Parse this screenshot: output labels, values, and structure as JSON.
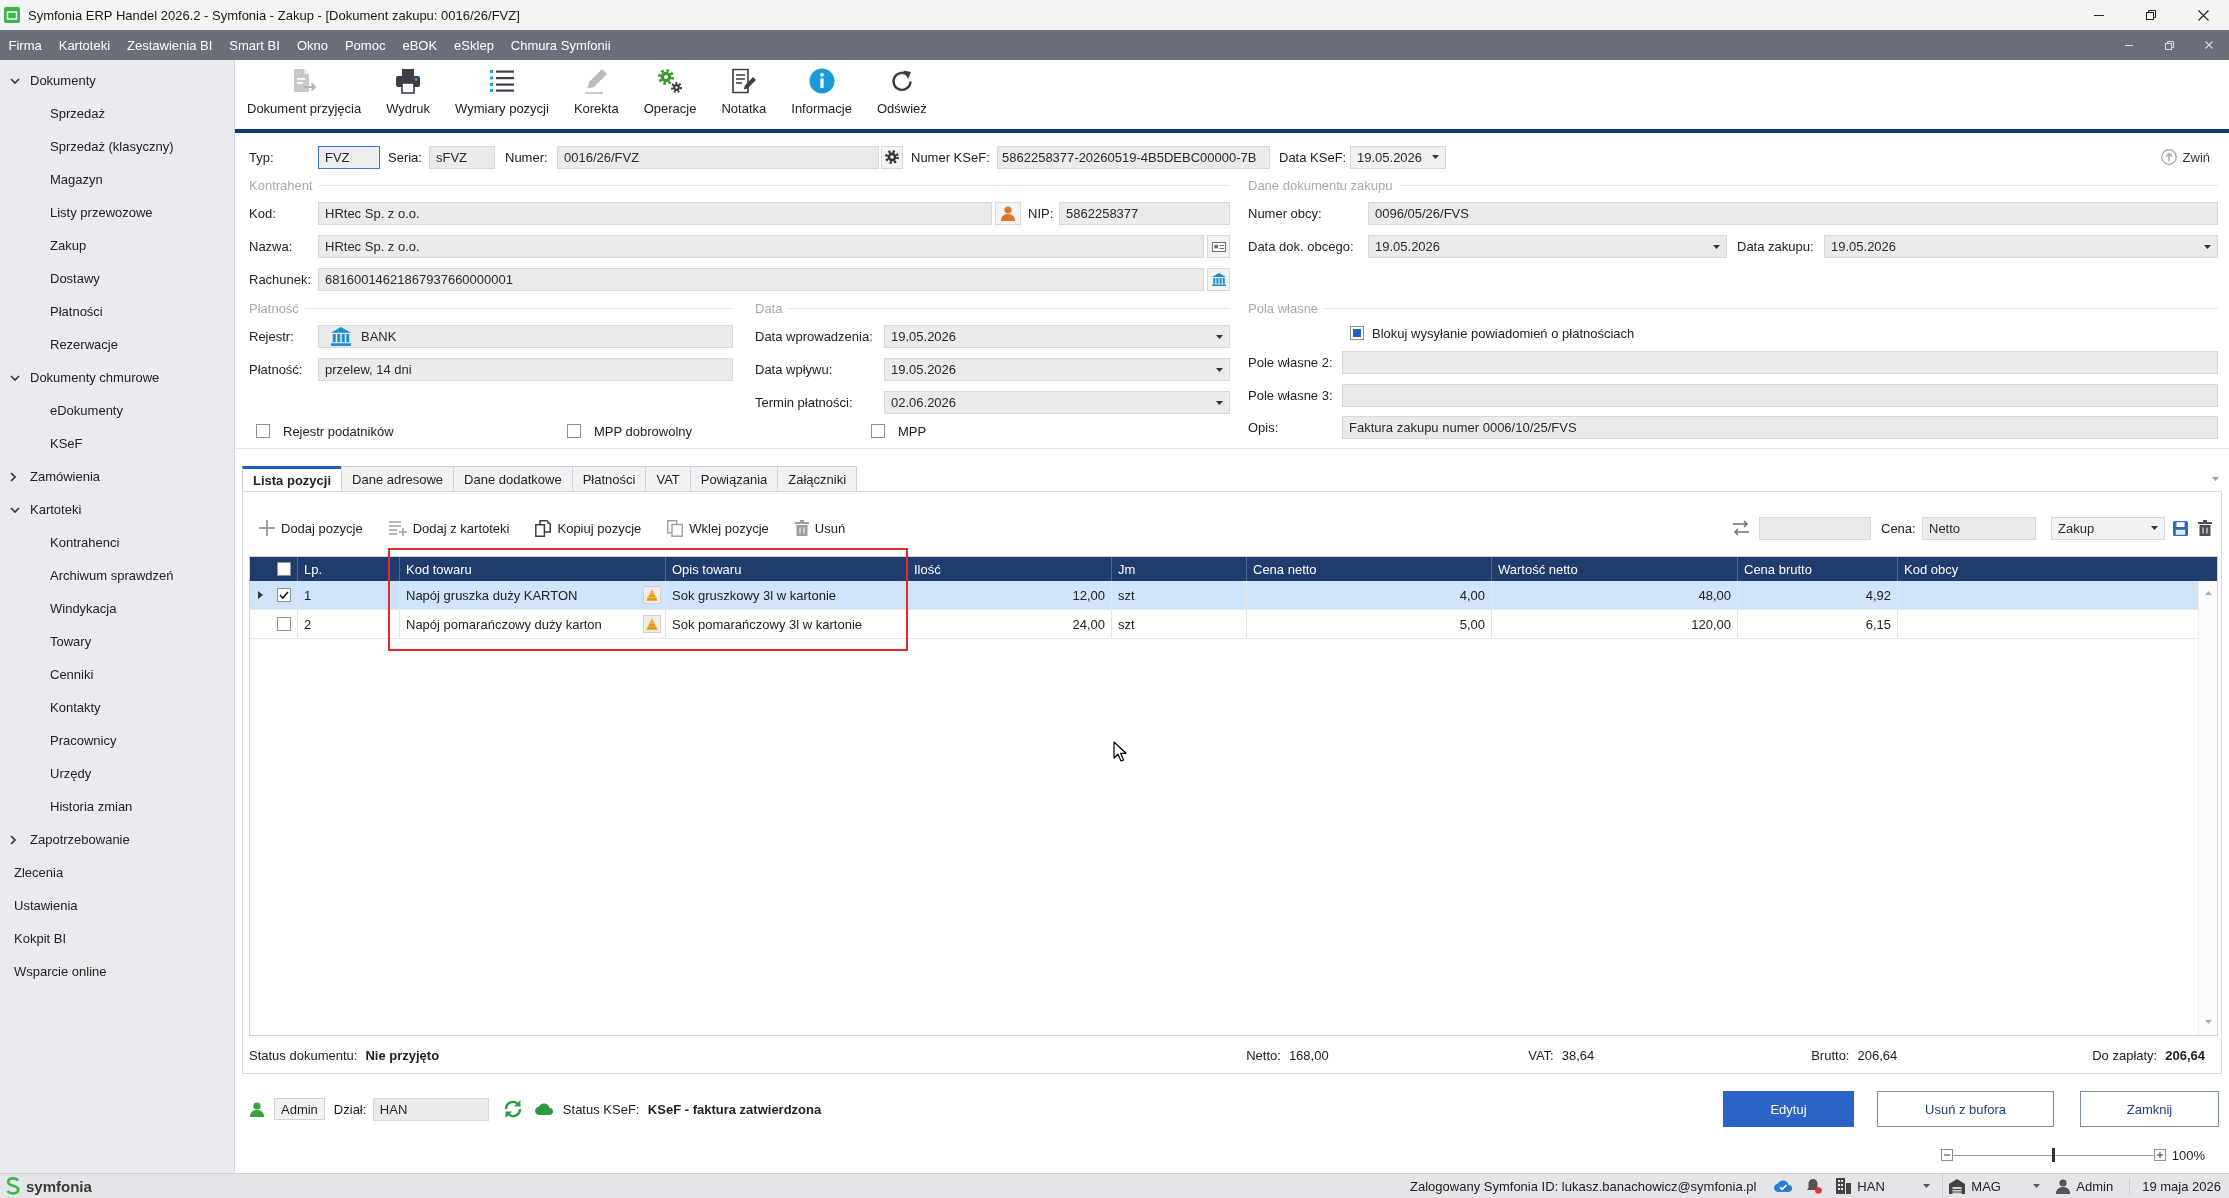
{
  "window": {
    "title": "Symfonia ERP Handel 2026.2 - Symfonia - Zakup - [Dokument zakupu: 0016/26/FVZ]"
  },
  "menu": [
    "Firma",
    "Kartoteki",
    "Zestawienia BI",
    "Smart BI",
    "Okno",
    "Pomoc",
    "eBOK",
    "eSklep",
    "Chmura Symfonii"
  ],
  "sidebar": {
    "items": [
      {
        "label": "Dokumenty",
        "expanded": true,
        "children": [
          {
            "label": "Sprzedaż"
          },
          {
            "label": "Sprzedaż (klasyczny)"
          },
          {
            "label": "Magazyn"
          },
          {
            "label": "Listy przewozowe"
          },
          {
            "label": "Zakup"
          },
          {
            "label": "Dostawy"
          },
          {
            "label": "Płatności"
          },
          {
            "label": "Rezerwacje"
          }
        ]
      },
      {
        "label": "Dokumenty chmurowe",
        "expanded": true,
        "children": [
          {
            "label": "eDokumenty"
          },
          {
            "label": "KSeF"
          }
        ]
      },
      {
        "label": "Zamówienia",
        "expanded": false
      },
      {
        "label": "Kartoteki",
        "expanded": true,
        "children": [
          {
            "label": "Kontrahenci"
          },
          {
            "label": "Archiwum sprawdzeń"
          },
          {
            "label": "Windykacja"
          },
          {
            "label": "Towary"
          },
          {
            "label": "Cenniki"
          },
          {
            "label": "Kontakty"
          },
          {
            "label": "Pracownicy"
          },
          {
            "label": "Urzędy"
          },
          {
            "label": "Historia zmian"
          }
        ]
      },
      {
        "label": "Zapotrzebowanie",
        "expanded": false
      },
      {
        "label": "Zlecenia"
      },
      {
        "label": "Ustawienia"
      },
      {
        "label": "Kokpit BI"
      },
      {
        "label": "Wsparcie online"
      }
    ]
  },
  "toolbar": [
    {
      "label": "Dokument przyjęcia",
      "disabled": true
    },
    {
      "label": "Wydruk",
      "disabled": false
    },
    {
      "label": "Wymiary pozycji",
      "disabled": false
    },
    {
      "label": "Korekta",
      "disabled": true
    },
    {
      "label": "Operacje",
      "disabled": false
    },
    {
      "label": "Notatka",
      "disabled": false
    },
    {
      "label": "Informacje",
      "disabled": false
    },
    {
      "label": "Odśwież",
      "disabled": false
    }
  ],
  "document": {
    "type": {
      "label": "Typ:",
      "value": "FVZ",
      "focused": true
    },
    "series": {
      "label": "Seria:",
      "value": "sFVZ"
    },
    "number": {
      "label": "Numer:",
      "value": "0016/26/FVZ"
    },
    "ksef_number": {
      "label": "Numer KSeF:",
      "value": "5862258377-20260519-4B5DEBC00000-7B"
    },
    "ksef_date": {
      "label": "Data KSeF:",
      "value": "19.05.2026"
    },
    "collapse_button": "Zwiń"
  },
  "contractor": {
    "title": "Kontrahent",
    "code": {
      "label": "Kod:",
      "value": "HRtec Sp. z o.o."
    },
    "nip": {
      "label": "NIP:",
      "value": "5862258377"
    },
    "name": {
      "label": "Nazwa:",
      "value": "HRtec Sp. z o.o."
    },
    "account": {
      "label": "Rachunek:",
      "value": "68160014621867937660000001"
    }
  },
  "payment": {
    "title": "Płatność",
    "register": {
      "label": "Rejestr:",
      "value": "BANK"
    },
    "method": {
      "label": "Płatność:",
      "value": "przelew, 14 dni"
    }
  },
  "dates": {
    "title": "Data",
    "entry": {
      "label": "Data wprowadzenia:",
      "value": "19.05.2026"
    },
    "receipt": {
      "label": "Data wpływu:",
      "value": "19.05.2026"
    },
    "due": {
      "label": "Termin płatności:",
      "value": "02.06.2026"
    }
  },
  "options": [
    {
      "label": "Rejestr podatników",
      "checked": false
    },
    {
      "label": "MPP dobrowolny",
      "checked": false
    },
    {
      "label": "MPP",
      "checked": false
    }
  ],
  "purchase_document": {
    "title": "Dane dokumentu zakupu",
    "foreign_number": {
      "label": "Numer obcy:",
      "value": "0096/05/26/FVS"
    },
    "foreign_date": {
      "label": "Data dok. obcego:",
      "value": "19.05.2026"
    },
    "purchase_date": {
      "label": "Data zakupu:",
      "value": "19.05.2026"
    }
  },
  "custom_fields": {
    "title": "Pola własne",
    "block_notifications": {
      "label": "Blokuj wysyłanie powiadomień o płatnościach",
      "checked": true
    },
    "field_2": {
      "label": "Pole własne 2:"
    },
    "field_3": {
      "label": "Pole własne 3:"
    },
    "description": {
      "label": "Opis:",
      "value": "Faktura zakupu numer 0006/10/25/FVS"
    }
  },
  "tabs": [
    {
      "label": "Lista pozycji",
      "selected": true
    },
    {
      "label": "Dane adresowe",
      "selected": false
    },
    {
      "label": "Dane dodatkowe",
      "selected": false
    },
    {
      "label": "Płatności",
      "selected": false
    },
    {
      "label": "VAT",
      "selected": false
    },
    {
      "label": "Powiązania",
      "selected": false
    },
    {
      "label": "Załączniki",
      "selected": false
    }
  ],
  "positions_toolbar": {
    "buttons": [
      "Dodaj pozycje",
      "Dodaj z kartoteki",
      "Kopiuj pozycje",
      "Wklej pozycje",
      "Usuń"
    ],
    "price": {
      "label": "Cena:",
      "value": "Netto"
    },
    "price_type": "Zakup"
  },
  "table": {
    "all_checked": false,
    "columns": [
      {
        "label": "Lp.",
        "highlighted": false
      },
      {
        "label": "Kod towaru",
        "highlighted": true
      },
      {
        "label": "Opis towaru",
        "highlighted": true
      },
      {
        "label": "Ilość",
        "highlighted": false
      },
      {
        "label": "Jm",
        "highlighted": false
      },
      {
        "label": "Cena netto",
        "highlighted": false
      },
      {
        "label": "Wartość netto",
        "highlighted": false
      },
      {
        "label": "Cena brutto",
        "highlighted": false
      },
      {
        "label": "Kod obcy",
        "highlighted": false
      }
    ],
    "rows": [
      {
        "selected": true,
        "checked": true,
        "cells": [
          "1",
          "Napój gruszka duży KARTON",
          "Sok gruszkowy 3l w kartonie",
          "12,00",
          "szt",
          "4,00",
          "48,00",
          "4,92"
        ]
      },
      {
        "selected": false,
        "checked": false,
        "cells": [
          "2",
          "Napój pomarańczowy duży karton",
          "Sok pomarańczowy 3l w kartonie",
          "24,00",
          "szt",
          "5,00",
          "120,00",
          "6,15"
        ]
      }
    ]
  },
  "summary": {
    "status_label": "Status dokumentu:",
    "status": "Nie przyjęto",
    "totals": [
      {
        "label": "Netto:",
        "value": "168,00",
        "kind": "amount"
      },
      {
        "label": "VAT:",
        "value": "38,64",
        "kind": "amount"
      },
      {
        "label": "Brutto:",
        "value": "206,64",
        "kind": "amount"
      },
      {
        "label": "Do zapłaty:",
        "value": "206,64",
        "kind": "due"
      }
    ]
  },
  "footer": {
    "user": "Admin",
    "department": {
      "label": "Dział:",
      "value": "HAN"
    },
    "ksef_status": {
      "label": "Status KSeF:",
      "value": "KSeF - faktura zatwierdzona"
    },
    "buttons": [
      {
        "label": "Edytuj",
        "kind": "primary"
      },
      {
        "label": "Usuń z bufora",
        "kind": "secondary"
      },
      {
        "label": "Zamknij",
        "kind": "secondary"
      }
    ],
    "zoom": {
      "level": 0.5,
      "reading": "100%"
    }
  },
  "status_bar": {
    "brand": "symfonia",
    "login": "Zalogowany Symfonia ID: lukasz.banachowicz@symfonia.pl",
    "department": "HAN",
    "warehouse": "MAG",
    "user": "Admin",
    "date": "19 maja 2026"
  }
}
